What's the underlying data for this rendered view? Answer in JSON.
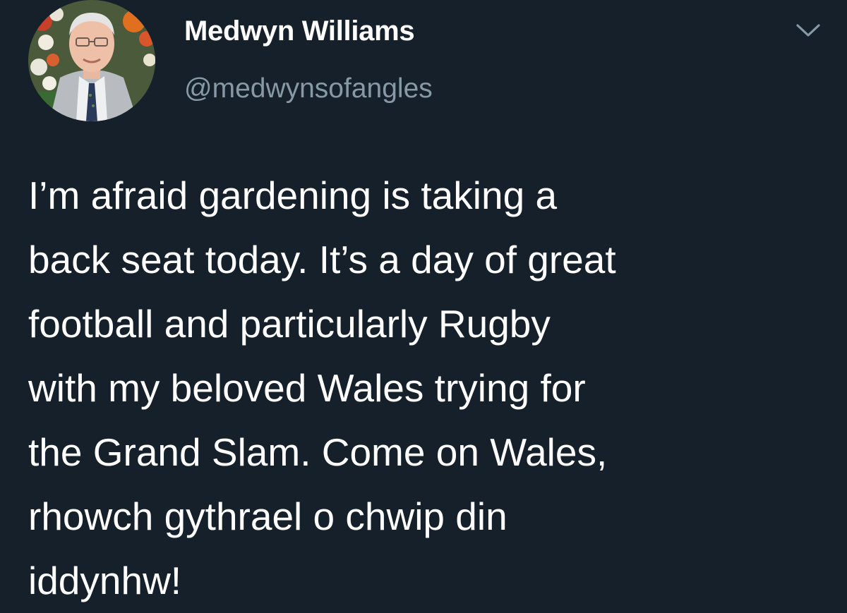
{
  "tweet": {
    "author": {
      "display_name": "Medwyn Williams",
      "handle": "@medwynsofangles",
      "avatar_icon": "user-avatar-photo"
    },
    "menu_icon": "chevron-down-icon",
    "text_lines": [
      "I’m afraid gardening is taking a",
      "back seat today. It’s a day of great",
      "football and particularly Rugby",
      "with my beloved Wales trying for",
      "the Grand Slam. Come on Wales,",
      "rhowch gythrael o chwip din",
      "iddynhw!"
    ]
  },
  "colors": {
    "background": "#15202b",
    "primary_text": "#ffffff",
    "secondary_text": "#8899a6"
  }
}
